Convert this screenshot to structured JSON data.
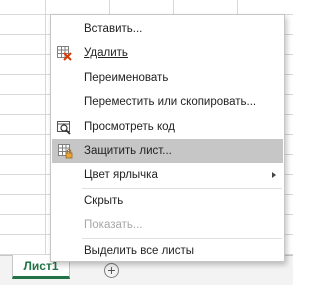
{
  "menu": {
    "items": [
      {
        "id": "insert",
        "label": "Вставить...",
        "disabled": false,
        "has_submenu": false
      },
      {
        "id": "delete",
        "label": "Удалить",
        "icon": "delete-sheet-icon",
        "disabled": false,
        "has_submenu": false
      },
      {
        "id": "rename",
        "label": "Переименовать",
        "disabled": false,
        "has_submenu": false
      },
      {
        "id": "move-copy",
        "label": "Переместить или скопировать...",
        "disabled": false,
        "has_submenu": false
      },
      {
        "id": "view-code",
        "label": "Просмотреть код",
        "icon": "view-code-icon",
        "disabled": false,
        "has_submenu": false
      },
      {
        "id": "protect-sheet",
        "label": "Защитить лист...",
        "icon": "protect-sheet-icon",
        "disabled": false,
        "has_submenu": false,
        "highlighted": true
      },
      {
        "id": "tab-color",
        "label": "Цвет ярлычка",
        "disabled": false,
        "has_submenu": true
      },
      {
        "id": "hide",
        "label": "Скрыть",
        "disabled": false,
        "has_submenu": false
      },
      {
        "id": "unhide",
        "label": "Показать...",
        "disabled": true,
        "has_submenu": false
      },
      {
        "id": "select-all-sheets",
        "label": "Выделить все листы",
        "disabled": false,
        "has_submenu": false
      }
    ]
  },
  "sheets": {
    "active_tab": "Лист1",
    "add_icon": "plus-circle-icon"
  },
  "colors": {
    "accent": "#217346",
    "highlight": "#c6c6c6",
    "delete_icon": "#d83b01",
    "disabled_text": "#a6a6a6"
  }
}
